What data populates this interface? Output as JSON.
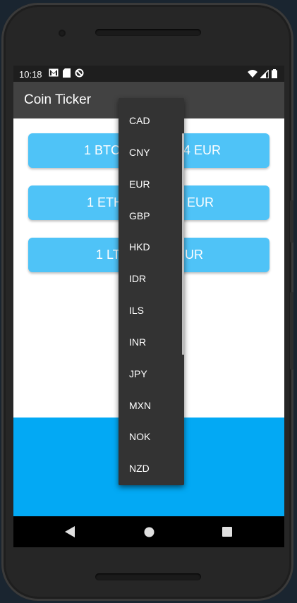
{
  "status_bar": {
    "time": "10:18"
  },
  "app_bar": {
    "title": "Coin Ticker"
  },
  "rates": [
    {
      "label": "1 BTC = ? EUR",
      "visible_left": "1 BTC",
      "visible_right": "4 EUR"
    },
    {
      "label": "1 ETH = ? EUR",
      "visible_left": "1 ETH",
      "visible_right": "EUR"
    },
    {
      "label": "1 LTC = ? EUR",
      "visible_left": "1 LT",
      "visible_right": "UR"
    }
  ],
  "currency_dropdown": {
    "options": [
      "CAD",
      "CNY",
      "EUR",
      "GBP",
      "HKD",
      "IDR",
      "ILS",
      "INR",
      "JPY",
      "MXN",
      "NOK",
      "NZD"
    ]
  },
  "colors": {
    "card": "#4fc3f7",
    "picker_bg": "#03a9f4",
    "app_bar": "#424242",
    "dropdown_bg": "#333333"
  },
  "icons": {
    "status_left": [
      "gmail-icon",
      "sd-card-icon",
      "no-sync-icon"
    ],
    "status_right": [
      "wifi-icon",
      "signal-icon",
      "battery-icon"
    ],
    "nav": [
      "back-icon",
      "home-icon",
      "recents-icon"
    ]
  }
}
